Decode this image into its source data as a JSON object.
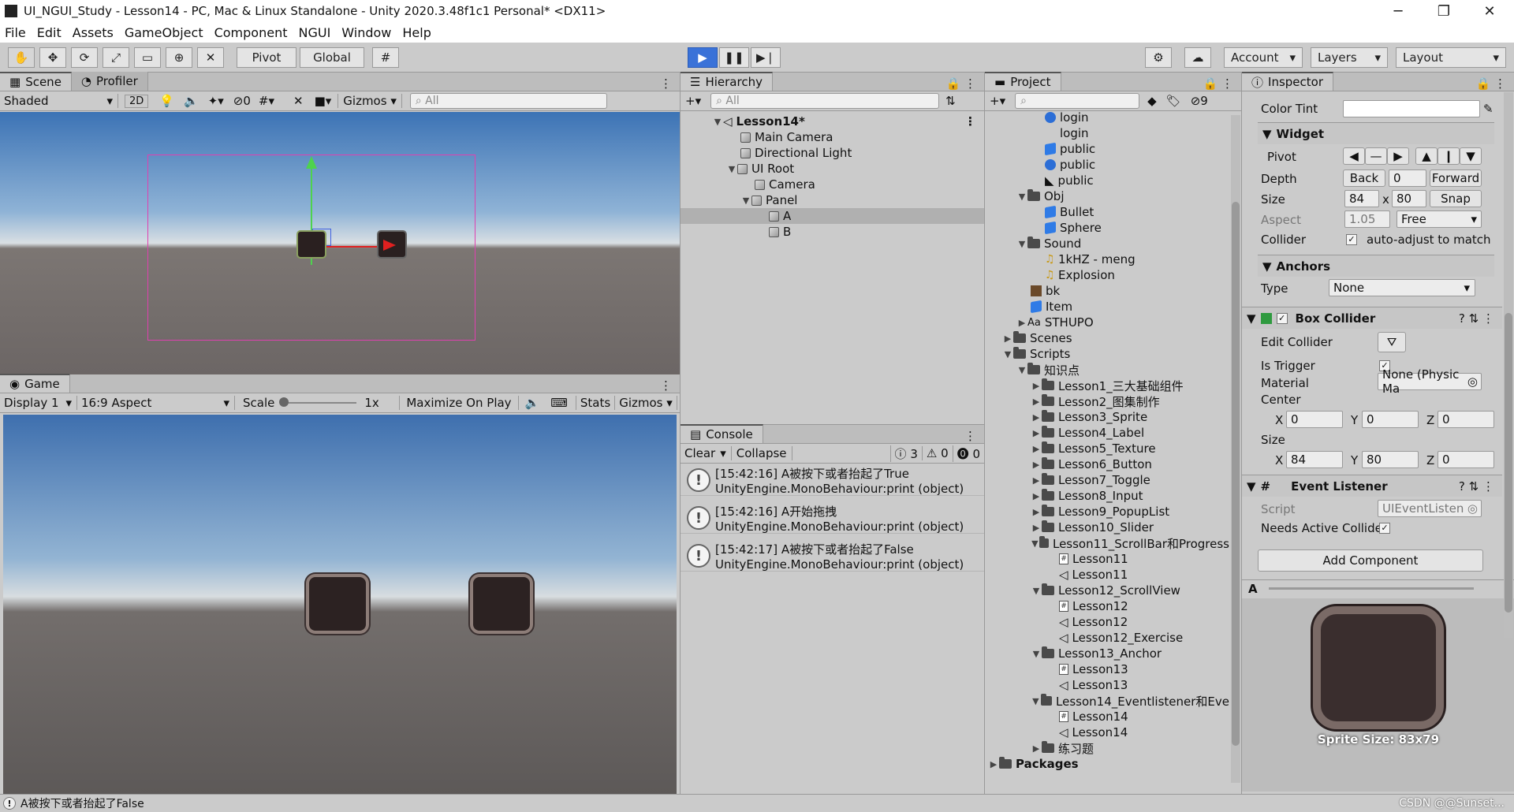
{
  "window": {
    "title": "UI_NGUI_Study - Lesson14 - PC, Mac & Linux Standalone - Unity 2020.3.48f1c1 Personal* <DX11>",
    "minimize": "─",
    "maximize": "❐",
    "close": "✕"
  },
  "menu": [
    "File",
    "Edit",
    "Assets",
    "GameObject",
    "Component",
    "NGUI",
    "Window",
    "Help"
  ],
  "toolbar": {
    "pivot": "Pivot",
    "global": "Global",
    "account": "Account",
    "layers": "Layers",
    "layout": "Layout"
  },
  "scene": {
    "tab": "Scene",
    "tab2": "Profiler",
    "shading": "Shaded",
    "mode2d": "2D",
    "hidden_count": "0",
    "gizmos": "Gizmos",
    "search_placeholder": "All"
  },
  "game": {
    "tab": "Game",
    "display": "Display 1",
    "aspect": "16:9 Aspect",
    "scale_label": "Scale",
    "scale_value": "1x",
    "maximize": "Maximize On Play",
    "stats": "Stats",
    "gizmos": "Gizmos"
  },
  "hierarchy": {
    "tab": "Hierarchy",
    "search_placeholder": "All",
    "root": "Lesson14*",
    "items": [
      "Main Camera",
      "Directional Light",
      "UI Root",
      "Camera",
      "Panel",
      "A",
      "B"
    ]
  },
  "console": {
    "tab": "Console",
    "clear": "Clear",
    "collapse": "Collapse",
    "info_count": "3",
    "warn_count": "0",
    "error_count": "0",
    "logs": [
      {
        "line1": "[15:42:16] A被按下或者抬起了True",
        "line2": "UnityEngine.MonoBehaviour:print (object)"
      },
      {
        "line1": "[15:42:16] A开始拖拽",
        "line2": "UnityEngine.MonoBehaviour:print (object)"
      },
      {
        "line1": "[15:42:17] A被按下或者抬起了False",
        "line2": "UnityEngine.MonoBehaviour:print (object)"
      }
    ]
  },
  "project": {
    "tab": "Project",
    "hidden_count": "9",
    "items": [
      "login",
      "login",
      "public",
      "public",
      "public",
      "Obj",
      "Bullet",
      "Sphere",
      "Sound",
      "1kHZ - meng",
      "Explosion",
      "bk",
      "Item",
      "STHUPO",
      "Scenes",
      "Scripts",
      "知识点",
      "Lesson1_三大基础组件",
      "Lesson2_图集制作",
      "Lesson3_Sprite",
      "Lesson4_Label",
      "Lesson5_Texture",
      "Lesson6_Button",
      "Lesson7_Toggle",
      "Lesson8_Input",
      "Lesson9_PopupList",
      "Lesson10_Slider",
      "Lesson11_ScrollBar和Progress",
      "Lesson11",
      "Lesson11",
      "Lesson12_ScrollView",
      "Lesson12",
      "Lesson12",
      "Lesson12_Exercise",
      "Lesson13_Anchor",
      "Lesson13",
      "Lesson13",
      "Lesson14_Eventlistener和Eve",
      "Lesson14",
      "Lesson14",
      "练习题",
      "Packages"
    ]
  },
  "inspector": {
    "tab": "Inspector",
    "color_tint": "Color Tint",
    "widget": "Widget",
    "pivot": "Pivot",
    "depth": "Depth",
    "back": "Back",
    "depth_value": "0",
    "forward": "Forward",
    "size": "Size",
    "size_x": "84",
    "size_y": "80",
    "snap": "Snap",
    "x_sep": "x",
    "aspect": "Aspect",
    "aspect_value": "1.05",
    "aspect_mode": "Free",
    "collider": "Collider",
    "auto_adjust": "auto-adjust to match",
    "anchors": "Anchors",
    "type": "Type",
    "type_value": "None",
    "box_collider": "Box Collider",
    "edit_collider": "Edit Collider",
    "is_trigger": "Is Trigger",
    "material": "Material",
    "material_value": "None (Physic Ma",
    "center": "Center",
    "cx": "0",
    "cy": "0",
    "cz": "0",
    "size2": "Size",
    "sx": "84",
    "sy": "80",
    "sz": "0",
    "lx": "X",
    "ly": "Y",
    "lz": "Z",
    "event_listener": "Event Listener",
    "script": "Script",
    "script_value": "UIEventListen",
    "needs_active": "Needs Active Collide",
    "add_component": "Add Component",
    "preview_label": "A",
    "sprite_size": "Sprite Size: 83x79"
  },
  "statusbar": {
    "message": "A被按下或者抬起了False",
    "watermark": "CSDN @@Sunset..."
  }
}
